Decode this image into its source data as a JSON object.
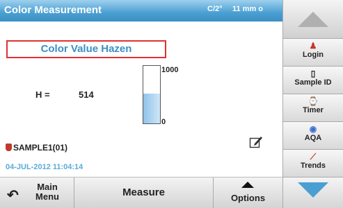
{
  "title": "Color Measurement",
  "mode": "C/2°",
  "size": "11 mm o",
  "measurement": {
    "label": "Color Value Hazen",
    "symbol": "H =",
    "value": "514",
    "bar": {
      "max_label": "1000",
      "min_label": "0",
      "fraction": 0.514
    }
  },
  "sample": "SAMPLE1(01)",
  "datetime": "04-JUL-2012  11:04:14",
  "bottom": {
    "main_menu": "Main\nMenu",
    "measure": "Measure",
    "options": "Options"
  },
  "side": {
    "login": "Login",
    "sample_id": "Sample ID",
    "timer": "Timer",
    "aqa": "AQA",
    "trends": "Trends"
  },
  "colors": {
    "accent": "#3b8fc4",
    "highlight_border": "#e03030",
    "bar_fill": "#8fc3ea"
  }
}
